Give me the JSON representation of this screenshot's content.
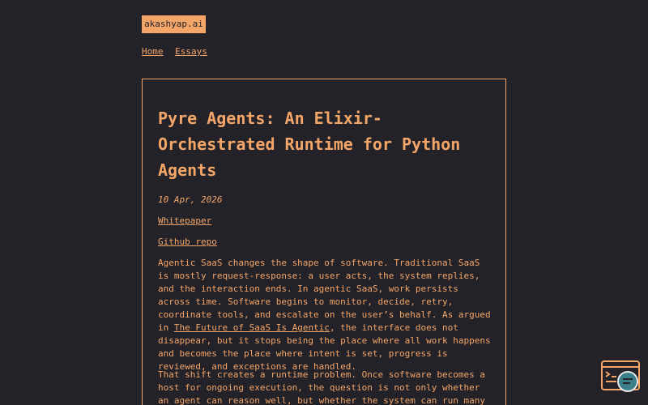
{
  "site": {
    "logo": "akashyap.ai"
  },
  "nav": {
    "items": [
      {
        "label": "Home"
      },
      {
        "label": "Essays"
      }
    ]
  },
  "article": {
    "title": "Pyre Agents: An Elixir-Orchestrated Runtime for Python Agents",
    "date": "10 Apr, 2026",
    "links": {
      "whitepaper": "Whitepaper",
      "github": "Github repo"
    },
    "p1_before": "Agentic SaaS changes the shape of software. Traditional SaaS is mostly request-response: a user acts, the system replies, and the interaction ends. In agentic SaaS, work persists across time. Software begins to monitor, decide, retry, coordinate tools, and escalate on the user’s behalf. As argued in ",
    "p1_link": "The Future of SaaS Is Agentic",
    "p1_after": ", the interface does not disappear, but it stops being the place where all work happens and becomes the place where intent is set, progress is reviewed, and exceptions are handled.",
    "p2": "That shift creates a runtime problem. Once software becomes a host for ongoing execution, the question is not only whether an agent can reason well, but whether the system can run many concurrent,"
  },
  "widget": {
    "icon": "terminal-chat-icon"
  },
  "colors": {
    "background": "#232229",
    "accent": "#f4a668",
    "widget_circle": "#3a7f89"
  }
}
